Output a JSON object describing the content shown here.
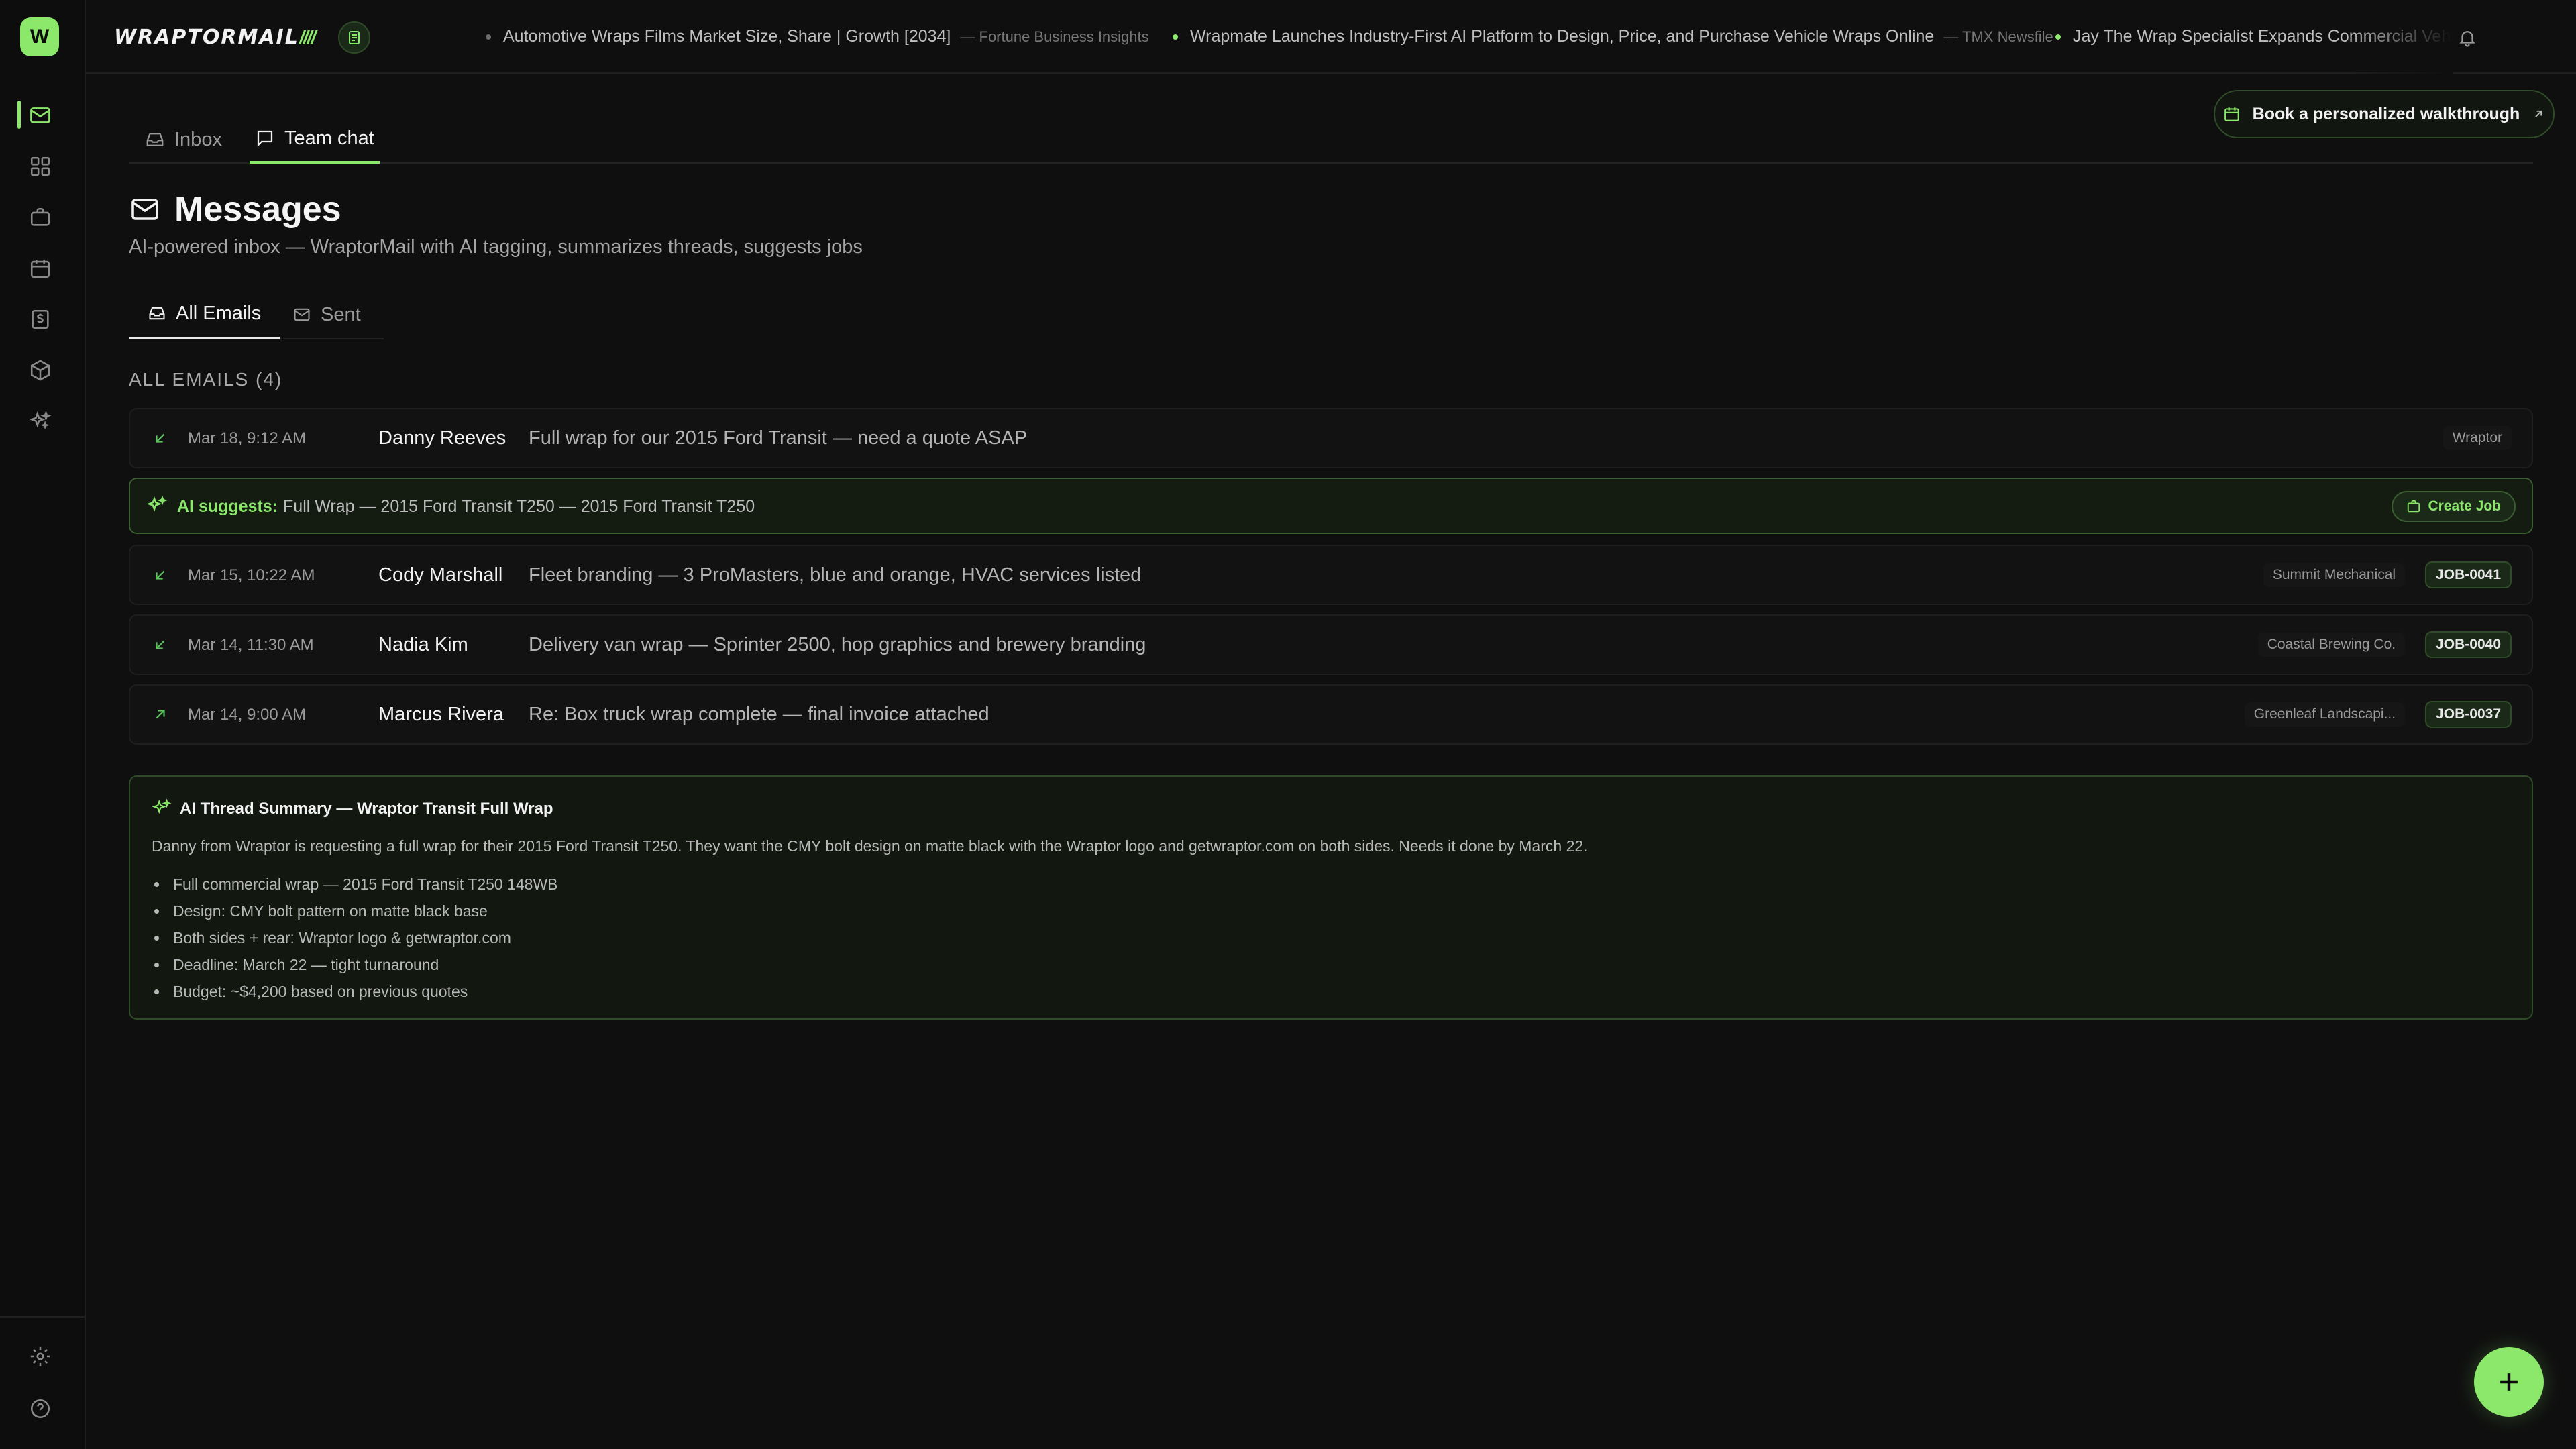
{
  "app": {
    "logo_letter": "W",
    "brand_name": "WRAPTORMAIL",
    "brand_stripes": "////",
    "avatar_initial": "W"
  },
  "sidebar": {
    "items": [
      {
        "name": "mail-icon",
        "active": true
      },
      {
        "name": "dashboard-icon",
        "active": false
      },
      {
        "name": "briefcase-icon",
        "active": false
      },
      {
        "name": "calendar-icon",
        "active": false
      },
      {
        "name": "invoice-icon",
        "active": false
      },
      {
        "name": "package-icon",
        "active": false
      },
      {
        "name": "sparkles-icon",
        "active": false
      }
    ],
    "bottom": [
      {
        "name": "settings-icon"
      },
      {
        "name": "help-icon"
      }
    ]
  },
  "ticker": [
    {
      "headline": "Automotive Wraps Films Market Size, Share | Growth [2034]",
      "source": "— Fortune Business Insights",
      "dot_color": "#6b6b6b"
    },
    {
      "headline": "Wrapmate Launches Industry-First AI Platform to Design, Price, and Purchase Vehicle Wraps Online",
      "source": "— TMX Newsfile",
      "dot_color": "#8be86b"
    },
    {
      "headline": "Jay The Wrap Specialist Expands Commercial Vehicle Wrap S",
      "source": "",
      "dot_color": "#8be86b"
    }
  ],
  "top_tabs": [
    {
      "label": "Inbox",
      "icon": "inbox-icon",
      "active": false
    },
    {
      "label": "Team chat",
      "icon": "chat-icon",
      "active": true
    }
  ],
  "walkthrough_label": "Book a personalized walkthrough",
  "page": {
    "title": "Messages",
    "subtitle": "AI-powered inbox — WraptorMail with AI tagging, summarizes threads, suggests jobs"
  },
  "sub_tabs": [
    {
      "label": "All Emails",
      "icon": "inbox-icon",
      "active": true
    },
    {
      "label": "Sent",
      "icon": "mail-icon",
      "active": false
    }
  ],
  "section_label": "ALL EMAILS (4)",
  "emails": [
    {
      "direction": "incoming",
      "date": "Mar 18, 9:12 AM",
      "sender": "Danny Reeves",
      "subject": "Full wrap for our 2015 Ford Transit — need a quote ASAP",
      "company": "Wraptor",
      "job": ""
    },
    {
      "direction": "incoming",
      "date": "Mar 15, 10:22 AM",
      "sender": "Cody Marshall",
      "subject": "Fleet branding — 3 ProMasters, blue and orange, HVAC services listed",
      "company": "Summit Mechanical",
      "job": "JOB-0041"
    },
    {
      "direction": "incoming",
      "date": "Mar 14, 11:30 AM",
      "sender": "Nadia Kim",
      "subject": "Delivery van wrap — Sprinter 2500, hop graphics and brewery branding",
      "company": "Coastal Brewing Co.",
      "job": "JOB-0040"
    },
    {
      "direction": "outgoing",
      "date": "Mar 14, 9:00 AM",
      "sender": "Marcus Rivera",
      "subject": "Re: Box truck wrap complete — final invoice attached",
      "company": "Greenleaf Landscapi...",
      "job": "JOB-0037"
    }
  ],
  "ai_suggestion": {
    "label": "AI suggests:",
    "text": "Full Wrap — 2015 Ford Transit T250 — 2015 Ford Transit T250",
    "button": "Create Job"
  },
  "thread_summary": {
    "title": "AI Thread Summary — Wraptor Transit Full Wrap",
    "body": "Danny from Wraptor is requesting a full wrap for their 2015 Ford Transit T250. They want the CMY bolt design on matte black with the Wraptor logo and getwraptor.com on both sides. Needs it done by March 22.",
    "bullets": [
      "Full commercial wrap — 2015 Ford Transit T250 148WB",
      "Design: CMY bolt pattern on matte black base",
      "Both sides + rear: Wraptor logo & getwraptor.com",
      "Deadline: March 22 — tight turnaround",
      "Budget: ~$4,200 based on previous quotes"
    ]
  },
  "fab_icon": "plus-icon",
  "colors": {
    "accent": "#8be86b",
    "background": "#0f0f0f",
    "surface": "#121212"
  }
}
